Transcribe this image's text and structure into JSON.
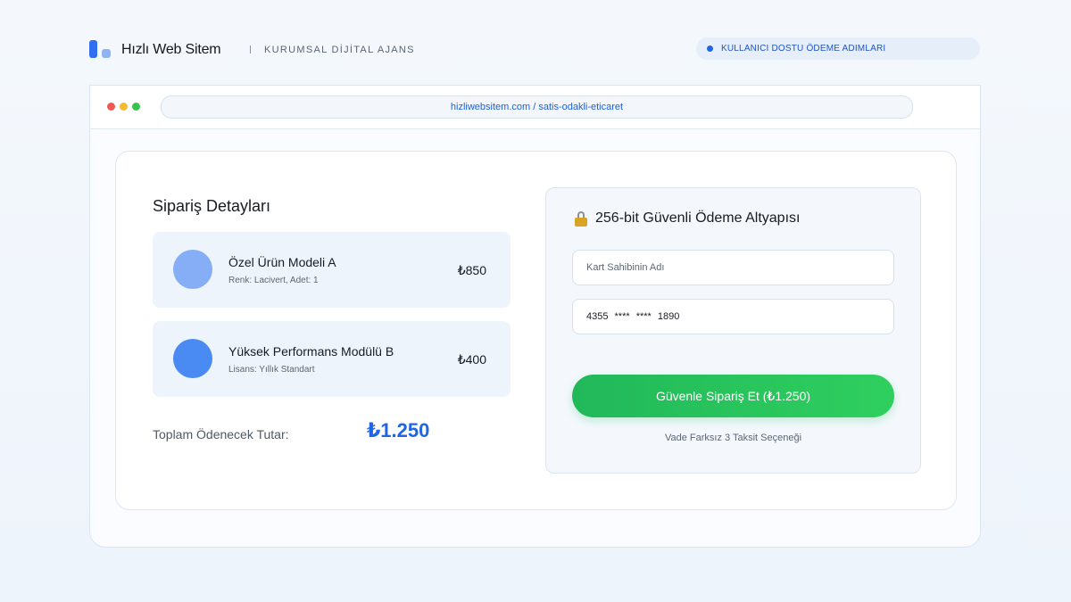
{
  "header": {
    "brand_name": "Hızlı Web Sitem",
    "tagline": "KURUMSAL DİJİTAL AJANS",
    "badge_label": "KULLANICI DOSTU ÖDEME ADIMLARI"
  },
  "browser": {
    "url": "hizliwebsitem.com / satis-odakli-eticaret"
  },
  "order": {
    "title": "Sipariş Detayları",
    "items": [
      {
        "name": "Özel Ürün Modeli A",
        "meta": "Renk: Lacivert, Adet: 1",
        "price": "₺850"
      },
      {
        "name": "Yüksek Performans Modülü B",
        "meta": "Lisans: Yıllık Standart",
        "price": "₺400"
      }
    ],
    "total_label": "Toplam Ödenecek Tutar:",
    "total_value": "₺1.250"
  },
  "payment": {
    "title": "256-bit Güvenli Ödeme Altyapısı",
    "cardholder_placeholder": "Kart Sahibinin Adı",
    "card_number": "4355 **** **** 1890",
    "submit_label": "Güvenle Sipariş Et (₺1.250)",
    "installment_note": "Vade Farksız 3 Taksit Seçeneği"
  },
  "colors": {
    "accent": "#1f66e6",
    "cta_green": "#2bc45d",
    "background": "#f1f6fc"
  },
  "icons": {
    "logo": "brand-logo-icon",
    "lock": "lock-icon"
  }
}
